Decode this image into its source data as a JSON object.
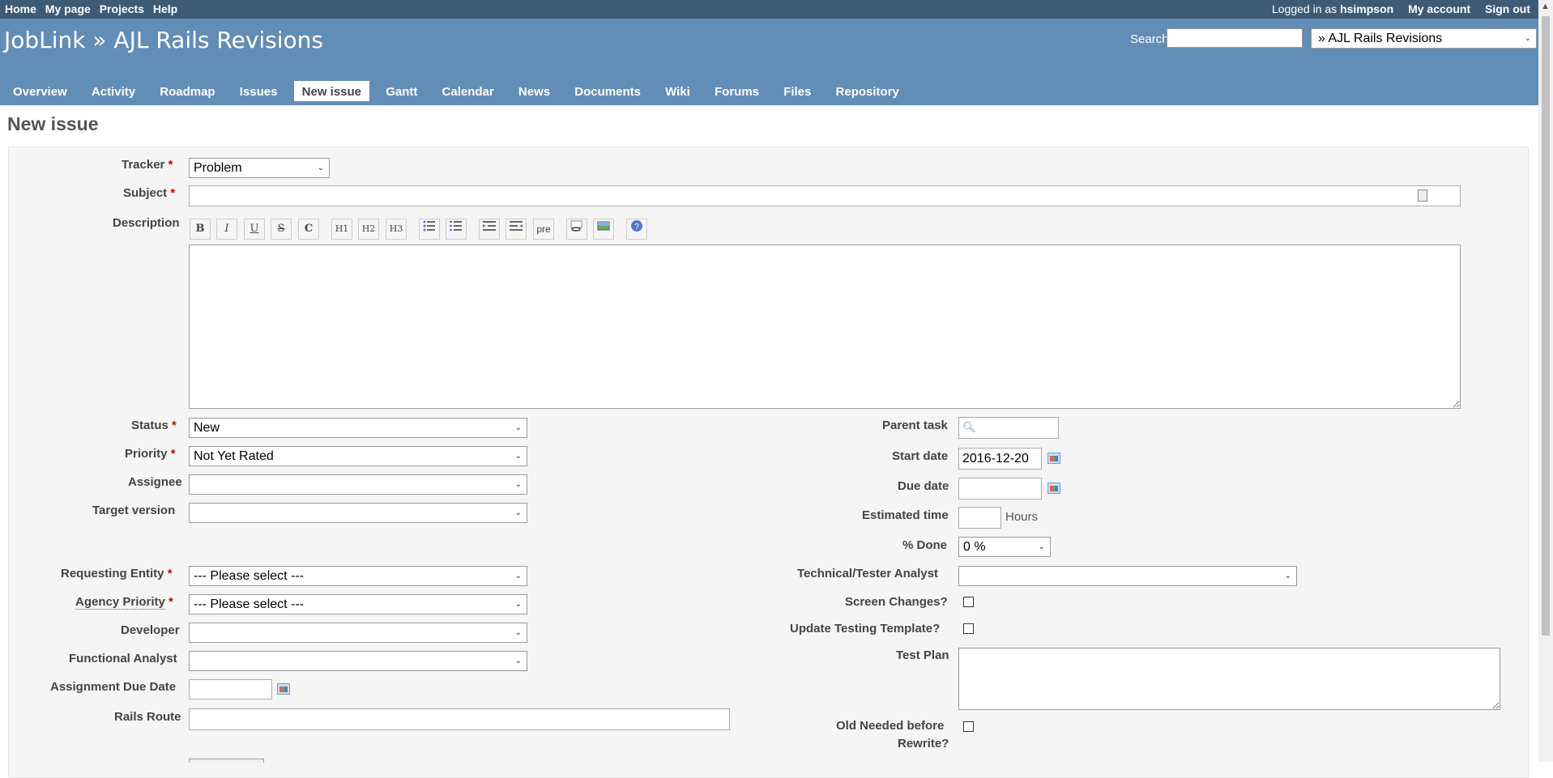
{
  "top_menu": {
    "links": [
      "Home",
      "My page",
      "Projects",
      "Help"
    ],
    "logged_in_prefix": "Logged in as",
    "username": "hsimpson",
    "my_account": "My account",
    "sign_out": "Sign out"
  },
  "header": {
    "title": "JobLink » AJL Rails Revisions",
    "search_label": "Search:",
    "search_value": "",
    "project_select": "» AJL Rails Revisions"
  },
  "main_menu": [
    "Overview",
    "Activity",
    "Roadmap",
    "Issues",
    "New issue",
    "Gantt",
    "Calendar",
    "News",
    "Documents",
    "Wiki",
    "Forums",
    "Files",
    "Repository"
  ],
  "active_tab": "New issue",
  "page_title": "New issue",
  "form": {
    "tracker_label": "Tracker",
    "tracker_value": "Problem",
    "subject_label": "Subject",
    "subject_value": "",
    "description_label": "Description",
    "toolbar": [
      "B",
      "I",
      "U",
      "S",
      "C",
      "H1",
      "H2",
      "H3",
      "ul",
      "ol",
      "indent-left",
      "indent-right",
      "pre",
      "link",
      "image",
      "help"
    ],
    "toolbar_labels": {
      "bold": "B",
      "italic": "I",
      "underline": "U",
      "strike": "S",
      "code": "C",
      "h1": "H1",
      "h2": "H2",
      "h3": "H3",
      "pre": "pre"
    },
    "status_label": "Status",
    "status_value": "New",
    "priority_label": "Priority",
    "priority_value": "Not Yet Rated",
    "assignee_label": "Assignee",
    "assignee_value": "",
    "target_version_label": "Target version",
    "target_version_value": "",
    "requesting_entity_label": "Requesting Entity",
    "requesting_entity_value": "--- Please select ---",
    "agency_priority_label": "Agency Priority",
    "agency_priority_value": "--- Please select ---",
    "developer_label": "Developer",
    "developer_value": "",
    "functional_analyst_label": "Functional Analyst",
    "functional_analyst_value": "",
    "assignment_due_date_label": "Assignment Due Date",
    "assignment_due_date_value": "",
    "rails_route_label": "Rails Route",
    "rails_route_value": "",
    "parent_task_label": "Parent task",
    "start_date_label": "Start date",
    "start_date_value": "2016-12-20",
    "due_date_label": "Due date",
    "due_date_value": "",
    "estimated_time_label": "Estimated time",
    "estimated_time_unit": "Hours",
    "done_label": "% Done",
    "done_value": "0 %",
    "tech_analyst_label": "Technical/Tester Analyst",
    "tech_analyst_value": "",
    "screen_changes_label": "Screen Changes?",
    "update_testing_label": "Update Testing Template?",
    "test_plan_label": "Test Plan",
    "old_needed_label_1": "Old Needed before",
    "old_needed_label_2": "Rewrite?"
  },
  "colors": {
    "top_bar": "#3e5b76",
    "header": "#628db6",
    "required": "#cc0000"
  }
}
